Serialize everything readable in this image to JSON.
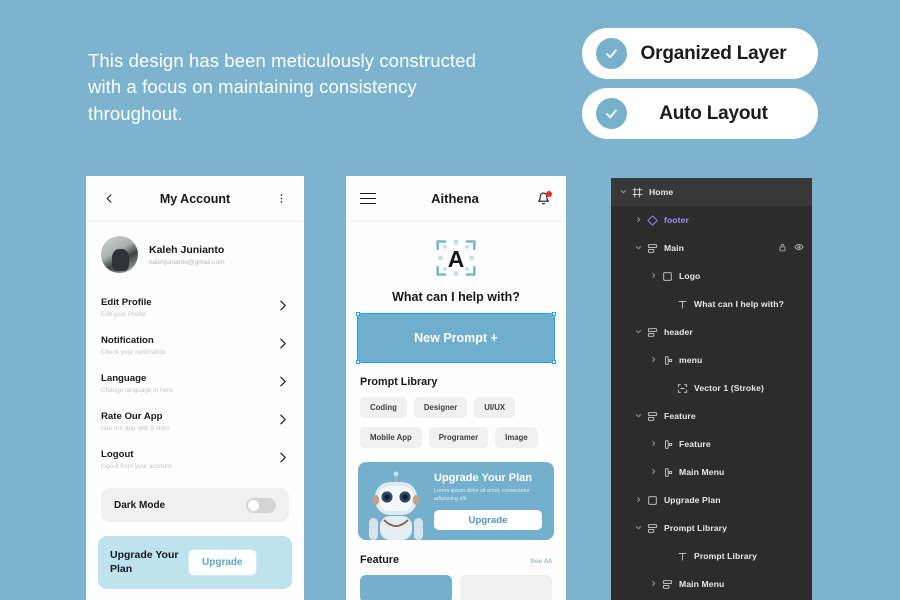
{
  "headline": "This design has been meticulously constructed with a focus on maintaining consistency throughout.",
  "badges": [
    {
      "label": "Organized Layer",
      "icon": "check-circle-icon"
    },
    {
      "label": "Auto Layout",
      "icon": "check-circle-icon"
    }
  ],
  "colors": {
    "background": "#7cb4d0",
    "accent_blue": "#74b0cd",
    "card_light_blue": "#bfe3ee",
    "panel_dark": "#2c2c2c",
    "component_purple": "#a78bfa",
    "selection_blue": "#1aa3ff",
    "notification_red": "#ef2b2b"
  },
  "account_screen": {
    "back_icon": "chevron-left-icon",
    "title": "My Account",
    "more_icon": "more-vertical-icon",
    "profile": {
      "name": "Kaleh Junianto",
      "email": "kalehjunianto@gmail.com"
    },
    "menu": [
      {
        "title": "Edit Profile",
        "sub": "Edit your Profile"
      },
      {
        "title": "Notification",
        "sub": "Check your notification"
      },
      {
        "title": "Language",
        "sub": "Change language in here"
      },
      {
        "title": "Rate Our App",
        "sub": "rate our app with 5 stars"
      },
      {
        "title": "Logout",
        "sub": "logout from your account"
      }
    ],
    "dark_mode": {
      "label": "Dark Mode",
      "enabled": false
    },
    "upgrade": {
      "title": "Upgrade Your Plan",
      "button": "Upgrade"
    }
  },
  "home_screen": {
    "menu_icon": "hamburger-icon",
    "title": "Aithena",
    "bell_icon": "bell-icon",
    "logo_letter": "A",
    "help_text": "What can I help with?",
    "new_prompt_button": "New Prompt +",
    "prompt_library": {
      "title": "Prompt Library",
      "tags_row_1": [
        "Coding",
        "Designer",
        "UI/UX"
      ],
      "tags_row_2": [
        "Mobile App",
        "Programer",
        "Image"
      ]
    },
    "upgrade_card": {
      "title": "Upgrade Your Plan",
      "subtitle": "Lorem ipsum dolor sit amet, consectetur adipiscing elit",
      "button": "Upgrade"
    },
    "feature": {
      "title": "Feature",
      "see_all": "See All"
    }
  },
  "layers_panel": {
    "rows": [
      {
        "label": "Home",
        "indent": 0,
        "icon": "frame-icon",
        "caret": "down",
        "selected": true,
        "type": "frame"
      },
      {
        "label": "footer",
        "indent": 1,
        "icon": "component-icon",
        "caret": "right",
        "selected": false,
        "type": "component"
      },
      {
        "label": "Main",
        "indent": 1,
        "icon": "autolayout-icon",
        "caret": "down",
        "selected": false,
        "type": "autolayout",
        "tools": [
          "lock-icon",
          "eye-icon"
        ]
      },
      {
        "label": "Logo",
        "indent": 2,
        "icon": "group-icon",
        "caret": "right",
        "selected": false,
        "type": "group"
      },
      {
        "label": "What can I help with?",
        "indent": 3,
        "icon": "text-icon",
        "caret": "none",
        "selected": false,
        "type": "text"
      },
      {
        "label": "header",
        "indent": 1,
        "icon": "autolayout-icon",
        "caret": "down",
        "selected": false,
        "type": "autolayout"
      },
      {
        "label": "menu",
        "indent": 2,
        "icon": "instance-icon",
        "caret": "right",
        "selected": false,
        "type": "instance"
      },
      {
        "label": "Vector 1 (Stroke)",
        "indent": 3,
        "icon": "vector-icon",
        "caret": "none",
        "selected": false,
        "type": "vector"
      },
      {
        "label": "Feature",
        "indent": 1,
        "icon": "autolayout-icon",
        "caret": "down",
        "selected": false,
        "type": "autolayout"
      },
      {
        "label": "Feature",
        "indent": 2,
        "icon": "instance-icon",
        "caret": "right",
        "selected": false,
        "type": "instance"
      },
      {
        "label": "Main Menu",
        "indent": 2,
        "icon": "instance-icon",
        "caret": "right",
        "selected": false,
        "type": "instance"
      },
      {
        "label": "Upgrade Plan",
        "indent": 1,
        "icon": "group-icon",
        "caret": "right",
        "selected": false,
        "type": "group"
      },
      {
        "label": "Prompt Library",
        "indent": 1,
        "icon": "autolayout-icon",
        "caret": "down",
        "selected": false,
        "type": "autolayout"
      },
      {
        "label": "Prompt Library",
        "indent": 3,
        "icon": "text-icon",
        "caret": "none",
        "selected": false,
        "type": "text"
      },
      {
        "label": "Main Menu",
        "indent": 2,
        "icon": "autolayout-icon",
        "caret": "right",
        "selected": false,
        "type": "autolayout"
      }
    ]
  }
}
